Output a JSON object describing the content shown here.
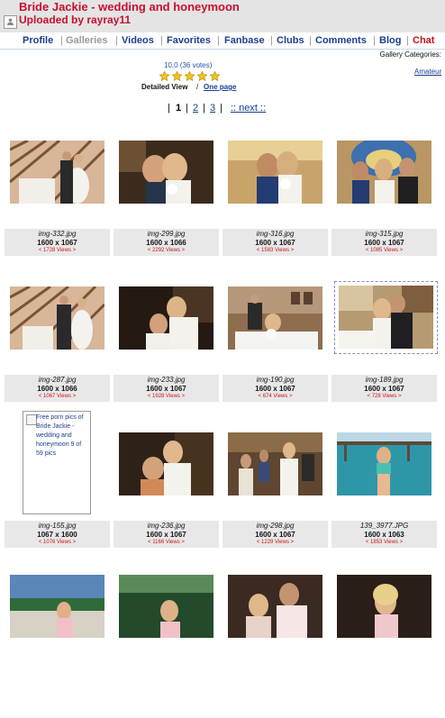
{
  "page": {
    "title": "Bride Jackie - wedding and honeymoon",
    "uploaded_by": "Uploaded by rayray11"
  },
  "nav": [
    {
      "label": "Profile"
    },
    {
      "label": "Galleries"
    },
    {
      "label": "Videos"
    },
    {
      "label": "Favorites"
    },
    {
      "label": "Fanbase"
    },
    {
      "label": "Clubs"
    },
    {
      "label": "Comments"
    },
    {
      "label": "Blog"
    },
    {
      "label": "Chat"
    }
  ],
  "sidebar": {
    "gallery_categories_label": "Gallery Categories:",
    "category": "Amateur"
  },
  "rating": {
    "text": "10,0 (36 votes)",
    "stars": 5
  },
  "view": {
    "detailed": "Detailed View",
    "separator": "/",
    "one_page": "One page"
  },
  "pager": {
    "bar": "|",
    "pages": [
      "1",
      "2",
      "3"
    ],
    "current": "1",
    "next": ":: next ::"
  },
  "photos": [
    {
      "file": "img-332.jpg",
      "dims": "1600 x 1067",
      "views": "< 1728 Views >"
    },
    {
      "file": "img-299.jpg",
      "dims": "1600 x 1066",
      "views": "< 2292 Views >"
    },
    {
      "file": "img-316.jpg",
      "dims": "1600 x 1067",
      "views": "< 1583 Views >"
    },
    {
      "file": "img-315.jpg",
      "dims": "1600 x 1067",
      "views": "< 1085 Views >"
    },
    {
      "file": "img-287.jpg",
      "dims": "1600 x 1066",
      "views": "< 1067 Views >"
    },
    {
      "file": "img-233.jpg",
      "dims": "1600 x 1067",
      "views": "< 1928 Views >"
    },
    {
      "file": "img-190.jpg",
      "dims": "1600 x 1067",
      "views": "< 674 Views >"
    },
    {
      "file": "img-189.jpg",
      "dims": "1600 x 1067",
      "views": "< 728 Views >"
    },
    {
      "file": "img-155.jpg",
      "dims": "1067 x 1600",
      "views": "< 1076 Views >",
      "ad_text": "Free porn pics of Bride Jackie - wedding and honeymoon 9 of 59 pics"
    },
    {
      "file": "img-236.jpg",
      "dims": "1600 x 1067",
      "views": "< 1166 Views >"
    },
    {
      "file": "img-298.jpg",
      "dims": "1600 x 1067",
      "views": "< 1229 Views >"
    },
    {
      "file": "139_3977.JPG",
      "dims": "1600 x 1063",
      "views": "< 1853 Views >"
    }
  ],
  "colors": {
    "brand_red": "#c8102e",
    "link_blue": "#1a3f8f",
    "header_gray": "#e4e4e4",
    "views_red": "#cc1111",
    "star_gold": "#f2c51a"
  },
  "icons": {
    "avatar": "user-avatar-icon",
    "star": "star-icon",
    "broken_image": "broken-image-icon"
  }
}
